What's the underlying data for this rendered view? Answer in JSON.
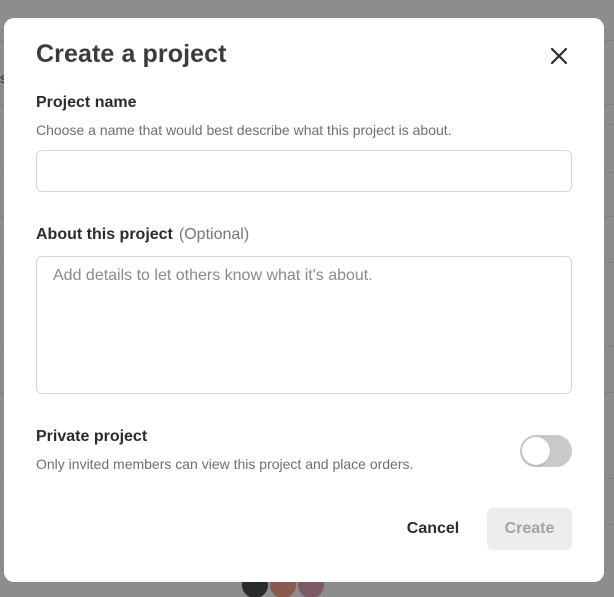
{
  "background": {
    "partial_text": "s"
  },
  "modal": {
    "title": "Create a project",
    "close_icon": "close-icon"
  },
  "fields": {
    "project_name": {
      "label": "Project name",
      "help": "Choose a name that would best describe what this project is about.",
      "value": "",
      "placeholder": ""
    },
    "about": {
      "label": "About this project",
      "optional": "(Optional)",
      "value": "",
      "placeholder": "Add details to let others know what it's about."
    },
    "private": {
      "label": "Private project",
      "help": "Only invited members can view this project and place orders.",
      "enabled": false
    }
  },
  "actions": {
    "cancel_label": "Cancel",
    "create_label": "Create",
    "create_disabled": true
  },
  "colors": {
    "overlay": "#8d8d8d",
    "toggle_off": "#c9c9c9",
    "disabled_button_bg": "#ededed",
    "disabled_button_text": "#a3a3a3"
  }
}
